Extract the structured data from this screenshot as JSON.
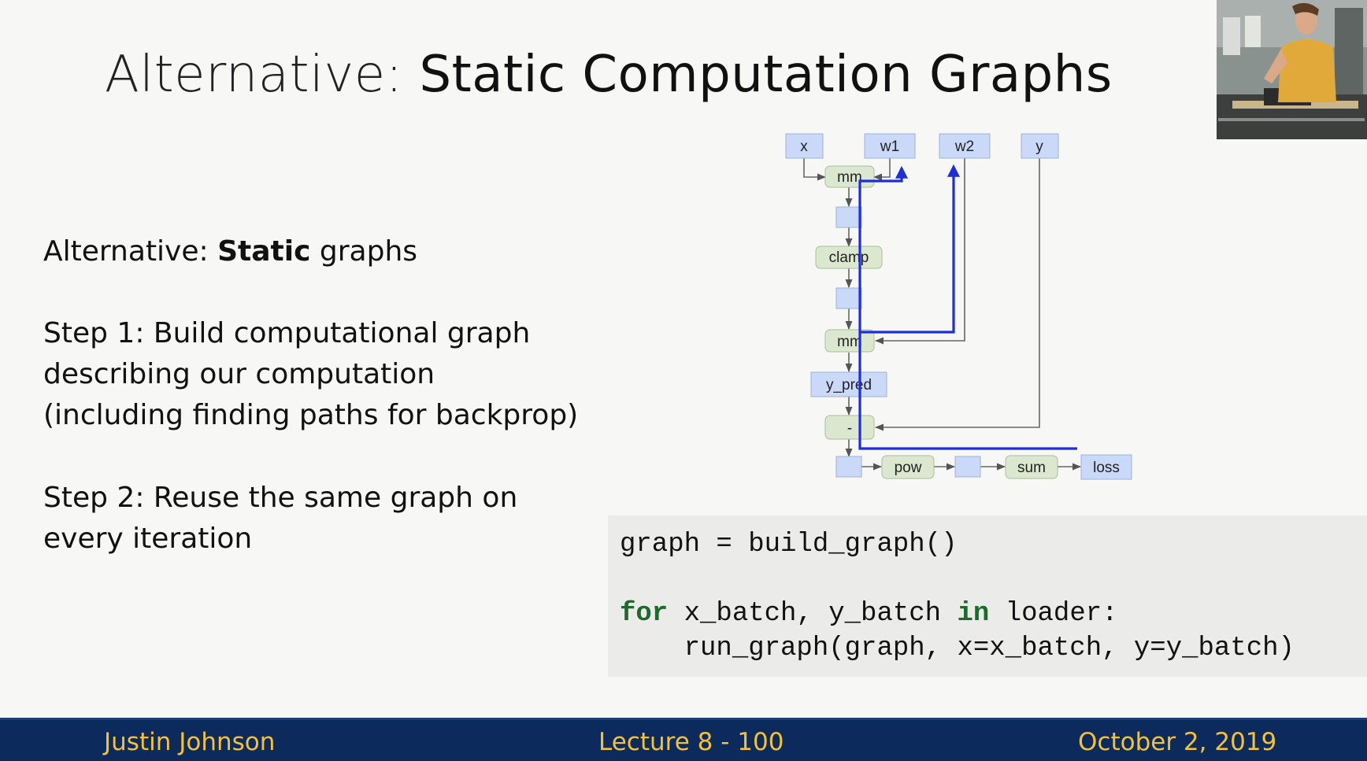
{
  "slide": {
    "title_prefix": "Alternative:",
    "title_main": "Static Computation Graphs",
    "bullets": {
      "alt_prefix": "Alternative:",
      "alt_bold": "Static",
      "alt_suffix": "graphs",
      "step1_line1": "Step 1: Build computational graph",
      "step1_line2": "describing our computation",
      "step1_line3": "(including finding paths for backprop)",
      "step2_line1": "Step 2: Reuse the same graph on",
      "step2_line2": "every iteration"
    },
    "graph_nodes": {
      "x": "x",
      "w1": "w1",
      "w2": "w2",
      "y": "y",
      "mm1": "mm",
      "clamp": "clamp",
      "mm2": "mm",
      "y_pred": "y_pred",
      "minus": "-",
      "pow": "pow",
      "sum": "sum",
      "loss": "loss"
    },
    "code": {
      "line1": "graph = build_graph()",
      "line2_kw1": "for",
      "line2_mid": " x_batch, y_batch ",
      "line2_kw2": "in",
      "line2_end": " loader:",
      "line3": "    run_graph(graph, x=x_batch, y=y_batch)"
    },
    "footer": {
      "author": "Justin Johnson",
      "lecture": "Lecture 8 - 100",
      "date": "October 2, 2019"
    },
    "colors": {
      "footer_bg": "#0c2a5c",
      "footer_text": "#f3c13a",
      "keyword": "#1d6b2a",
      "backprop_path": "#1f2fd6",
      "tensor_node": "#c9d9f7",
      "op_node": "#dbe8cf"
    }
  }
}
